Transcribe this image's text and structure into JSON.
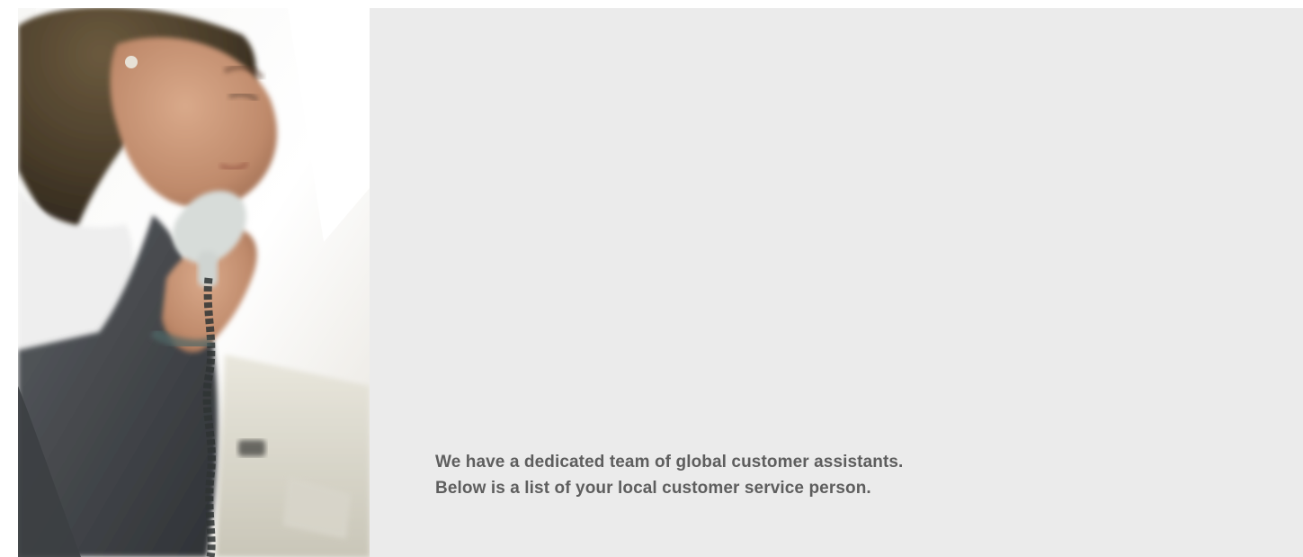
{
  "hero": {
    "image": {
      "icon": "customer-service-woman-on-phone-photo",
      "alt": ""
    },
    "intro_lines": [
      "We have a dedicated team of global customer assistants.",
      "Below is a list of your local customer service person."
    ],
    "colors": {
      "panel_background": "#ebebeb",
      "text": "#5e5e5e"
    }
  }
}
